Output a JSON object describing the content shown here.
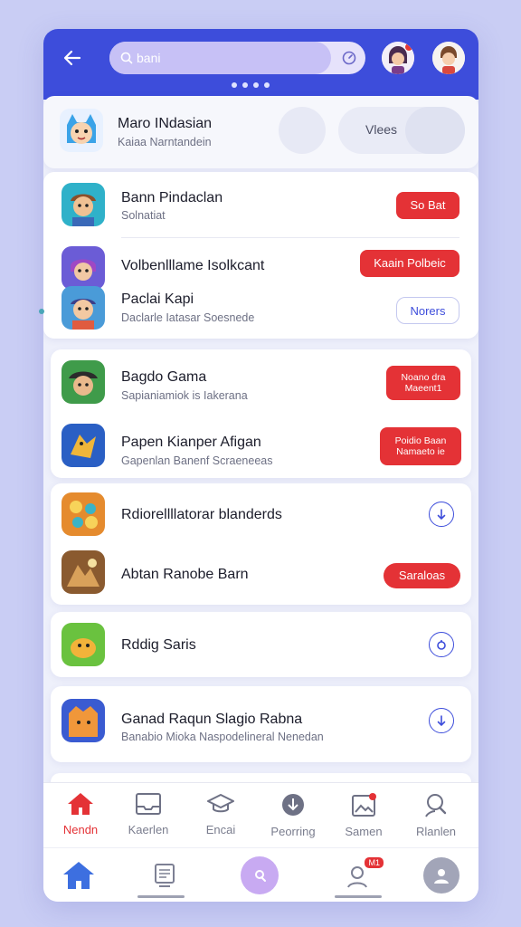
{
  "header": {
    "search_placeholder": "bani",
    "dots_count": 4
  },
  "featured": {
    "title": "Maro INdasian",
    "subtitle": "Kaiaa Narntandein",
    "views_label": "Vlees"
  },
  "group1": [
    {
      "title": "Bann Pindaclan",
      "subtitle": "Solnatiat",
      "button": "So Bat",
      "button_style": "red"
    },
    {
      "title": "Volbenlllame Isolkcant",
      "subtitle": "",
      "button": "Kaain Polbeic",
      "button_style": "red"
    },
    {
      "title": "Paclai Kapi",
      "subtitle": "Daclarle Iatasar Soesnede",
      "button": "Norers",
      "button_style": "outline"
    }
  ],
  "group2": [
    {
      "title": "Bagdo Gama",
      "subtitle": "Sapianiamiok is Iakerana",
      "button": "Noano dra Maeent1",
      "button_style": "red"
    },
    {
      "title": "Papen Kianper Afigan",
      "subtitle": "Gapenlan Banenf Scraeneeas",
      "button": "Poidio Baan Namaeto ie",
      "button_style": "red"
    }
  ],
  "group3": [
    {
      "title": "Rdiorellllatorar blanderds",
      "subtitle": "",
      "button_style": "circle"
    },
    {
      "title": "Abtan Ranobe Barn",
      "subtitle": "",
      "button": "Saraloas",
      "button_style": "red"
    }
  ],
  "group4": [
    {
      "title": "Rddig Saris",
      "subtitle": "",
      "button_style": "circle"
    }
  ],
  "group5": [
    {
      "title": "Ganad Raqun Slagio Rabna",
      "subtitle": "Banabio Mioka Naspodelineral Nenedan",
      "button_style": "circle"
    }
  ],
  "bottom_nav": [
    {
      "label": "Nendn",
      "icon": "home-icon",
      "active": true
    },
    {
      "label": "Kaerlen",
      "icon": "inbox-icon",
      "active": false
    },
    {
      "label": "Encai",
      "icon": "graduation-cap-icon",
      "active": false
    },
    {
      "label": "Peorring",
      "icon": "download-icon",
      "active": false
    },
    {
      "label": "Samen",
      "icon": "gallery-icon",
      "active": false
    },
    {
      "label": "Rlanlen",
      "icon": "user-search-icon",
      "active": false
    }
  ],
  "tabbar": {
    "notif_badge": "M1"
  },
  "colors": {
    "primary": "#3d4ddb",
    "accent_red": "#e43236",
    "background": "#c9cdf4"
  }
}
